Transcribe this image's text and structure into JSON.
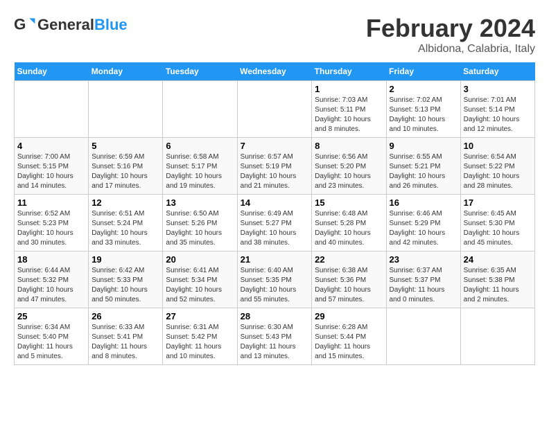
{
  "header": {
    "logo_general": "General",
    "logo_blue": "Blue",
    "month_title": "February 2024",
    "location": "Albidona, Calabria, Italy"
  },
  "days_of_week": [
    "Sunday",
    "Monday",
    "Tuesday",
    "Wednesday",
    "Thursday",
    "Friday",
    "Saturday"
  ],
  "weeks": [
    [
      {
        "day": "",
        "info": ""
      },
      {
        "day": "",
        "info": ""
      },
      {
        "day": "",
        "info": ""
      },
      {
        "day": "",
        "info": ""
      },
      {
        "day": "1",
        "info": "Sunrise: 7:03 AM\nSunset: 5:11 PM\nDaylight: 10 hours\nand 8 minutes."
      },
      {
        "day": "2",
        "info": "Sunrise: 7:02 AM\nSunset: 5:13 PM\nDaylight: 10 hours\nand 10 minutes."
      },
      {
        "day": "3",
        "info": "Sunrise: 7:01 AM\nSunset: 5:14 PM\nDaylight: 10 hours\nand 12 minutes."
      }
    ],
    [
      {
        "day": "4",
        "info": "Sunrise: 7:00 AM\nSunset: 5:15 PM\nDaylight: 10 hours\nand 14 minutes."
      },
      {
        "day": "5",
        "info": "Sunrise: 6:59 AM\nSunset: 5:16 PM\nDaylight: 10 hours\nand 17 minutes."
      },
      {
        "day": "6",
        "info": "Sunrise: 6:58 AM\nSunset: 5:17 PM\nDaylight: 10 hours\nand 19 minutes."
      },
      {
        "day": "7",
        "info": "Sunrise: 6:57 AM\nSunset: 5:19 PM\nDaylight: 10 hours\nand 21 minutes."
      },
      {
        "day": "8",
        "info": "Sunrise: 6:56 AM\nSunset: 5:20 PM\nDaylight: 10 hours\nand 23 minutes."
      },
      {
        "day": "9",
        "info": "Sunrise: 6:55 AM\nSunset: 5:21 PM\nDaylight: 10 hours\nand 26 minutes."
      },
      {
        "day": "10",
        "info": "Sunrise: 6:54 AM\nSunset: 5:22 PM\nDaylight: 10 hours\nand 28 minutes."
      }
    ],
    [
      {
        "day": "11",
        "info": "Sunrise: 6:52 AM\nSunset: 5:23 PM\nDaylight: 10 hours\nand 30 minutes."
      },
      {
        "day": "12",
        "info": "Sunrise: 6:51 AM\nSunset: 5:24 PM\nDaylight: 10 hours\nand 33 minutes."
      },
      {
        "day": "13",
        "info": "Sunrise: 6:50 AM\nSunset: 5:26 PM\nDaylight: 10 hours\nand 35 minutes."
      },
      {
        "day": "14",
        "info": "Sunrise: 6:49 AM\nSunset: 5:27 PM\nDaylight: 10 hours\nand 38 minutes."
      },
      {
        "day": "15",
        "info": "Sunrise: 6:48 AM\nSunset: 5:28 PM\nDaylight: 10 hours\nand 40 minutes."
      },
      {
        "day": "16",
        "info": "Sunrise: 6:46 AM\nSunset: 5:29 PM\nDaylight: 10 hours\nand 42 minutes."
      },
      {
        "day": "17",
        "info": "Sunrise: 6:45 AM\nSunset: 5:30 PM\nDaylight: 10 hours\nand 45 minutes."
      }
    ],
    [
      {
        "day": "18",
        "info": "Sunrise: 6:44 AM\nSunset: 5:32 PM\nDaylight: 10 hours\nand 47 minutes."
      },
      {
        "day": "19",
        "info": "Sunrise: 6:42 AM\nSunset: 5:33 PM\nDaylight: 10 hours\nand 50 minutes."
      },
      {
        "day": "20",
        "info": "Sunrise: 6:41 AM\nSunset: 5:34 PM\nDaylight: 10 hours\nand 52 minutes."
      },
      {
        "day": "21",
        "info": "Sunrise: 6:40 AM\nSunset: 5:35 PM\nDaylight: 10 hours\nand 55 minutes."
      },
      {
        "day": "22",
        "info": "Sunrise: 6:38 AM\nSunset: 5:36 PM\nDaylight: 10 hours\nand 57 minutes."
      },
      {
        "day": "23",
        "info": "Sunrise: 6:37 AM\nSunset: 5:37 PM\nDaylight: 11 hours\nand 0 minutes."
      },
      {
        "day": "24",
        "info": "Sunrise: 6:35 AM\nSunset: 5:38 PM\nDaylight: 11 hours\nand 2 minutes."
      }
    ],
    [
      {
        "day": "25",
        "info": "Sunrise: 6:34 AM\nSunset: 5:40 PM\nDaylight: 11 hours\nand 5 minutes."
      },
      {
        "day": "26",
        "info": "Sunrise: 6:33 AM\nSunset: 5:41 PM\nDaylight: 11 hours\nand 8 minutes."
      },
      {
        "day": "27",
        "info": "Sunrise: 6:31 AM\nSunset: 5:42 PM\nDaylight: 11 hours\nand 10 minutes."
      },
      {
        "day": "28",
        "info": "Sunrise: 6:30 AM\nSunset: 5:43 PM\nDaylight: 11 hours\nand 13 minutes."
      },
      {
        "day": "29",
        "info": "Sunrise: 6:28 AM\nSunset: 5:44 PM\nDaylight: 11 hours\nand 15 minutes."
      },
      {
        "day": "",
        "info": ""
      },
      {
        "day": "",
        "info": ""
      }
    ]
  ]
}
